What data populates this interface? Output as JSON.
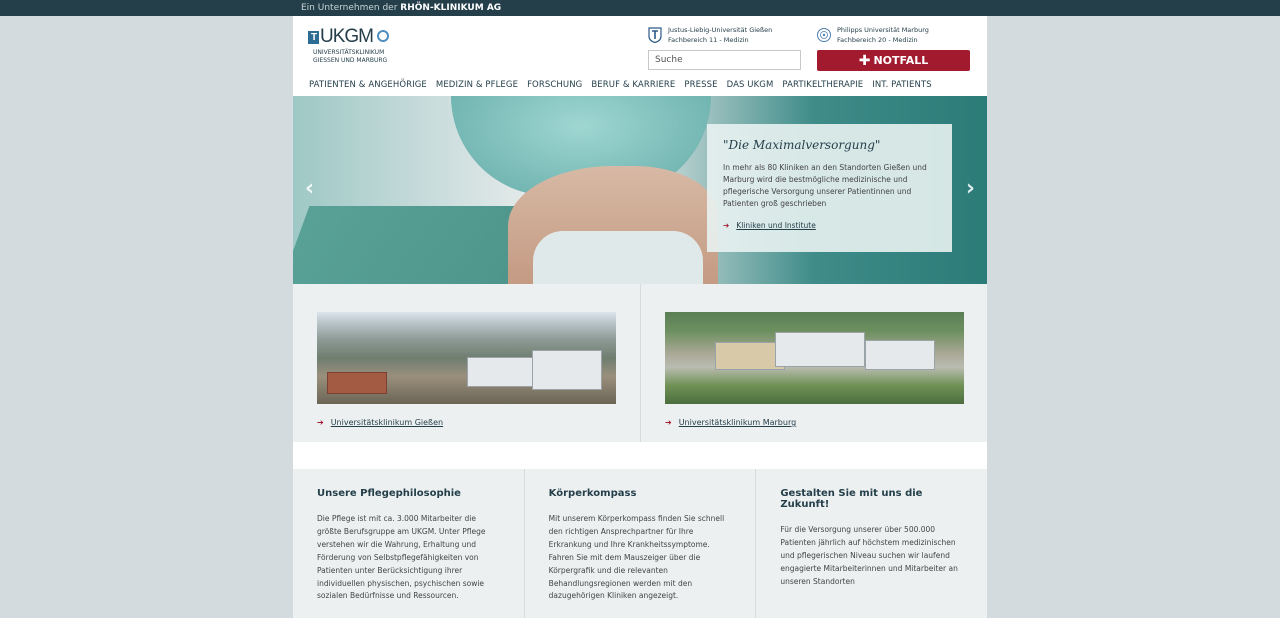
{
  "topbar": {
    "prefix": "Ein Unternehmen der",
    "brand": "RHÖN-KLINIKUM AG"
  },
  "logo": {
    "word": "UKGM",
    "t_letter": "T",
    "sub1": "UNIVERSITÄTSKLINIKUM",
    "sub2": "GIESSEN UND MARBURG"
  },
  "universities": [
    {
      "name": "Justus-Liebig-Universität Gießen",
      "dept": "Fachbereich 11 - Medizin"
    },
    {
      "name": "Philipps Universität Marburg",
      "dept": "Fachbereich 20 - Medizin"
    }
  ],
  "search": {
    "placeholder": "Suche"
  },
  "notfall": {
    "label": "NOTFALL"
  },
  "nav": [
    "PATIENTEN & ANGEHÖRIGE",
    "MEDIZIN & PFLEGE",
    "FORSCHUNG",
    "BERUF & KARRIERE",
    "PRESSE",
    "DAS UKGM",
    "PARTIKELTHERAPIE",
    "INT. PATIENTS"
  ],
  "hero": {
    "title": "\"Die Maximalversorgung\"",
    "text": "In mehr als 80 Kliniken an den Standorten Gießen und Marburg wird die bestmögliche medizinische und pflegerische Versorgung unserer Patientinnen und Patienten groß geschrieben",
    "link": "Kliniken und Institute",
    "prev": "‹",
    "next": "›"
  },
  "clinics": [
    {
      "link": "Universitätsklinikum Gießen"
    },
    {
      "link": "Universitätsklinikum Marburg"
    }
  ],
  "columns": [
    {
      "title": "Unsere Pflegephilosophie",
      "text": "Die Pflege ist mit ca. 3.000 Mitarbeiter die größte Berufsgruppe am UKGM. Unter Pflege verstehen wir die Wahrung, Erhaltung und Förderung von Selbstpflegefähigkeiten von Patienten unter Berücksichtigung ihrer individuellen physischen, psychischen sowie sozialen Bedürfnisse und Ressourcen."
    },
    {
      "title": "Körperkompass",
      "text": "Mit unserem Körperkompass finden Sie schnell den richtigen Ansprechpartner für Ihre Erkrankung und Ihre Krankheitssymptome. Fahren Sie mit dem Mauszeiger über die Körpergrafik und die relevanten Behandlungsregionen werden mit den dazugehörigen Kliniken angezeigt."
    },
    {
      "title": "Gestalten Sie mit uns die Zukunft!",
      "text": "Für die Versorgung unserer über 500.000 Patienten jährlich auf höchstem medizinischen und pflegerischen Niveau suchen wir laufend engagierte Mitarbeiterinnen und Mitarbeiter an unseren Standorten"
    }
  ],
  "colors": {
    "accent": "#a21a2e",
    "navy": "#243f4a",
    "topbar": "#243f4a",
    "panel": "#edf0f1"
  }
}
